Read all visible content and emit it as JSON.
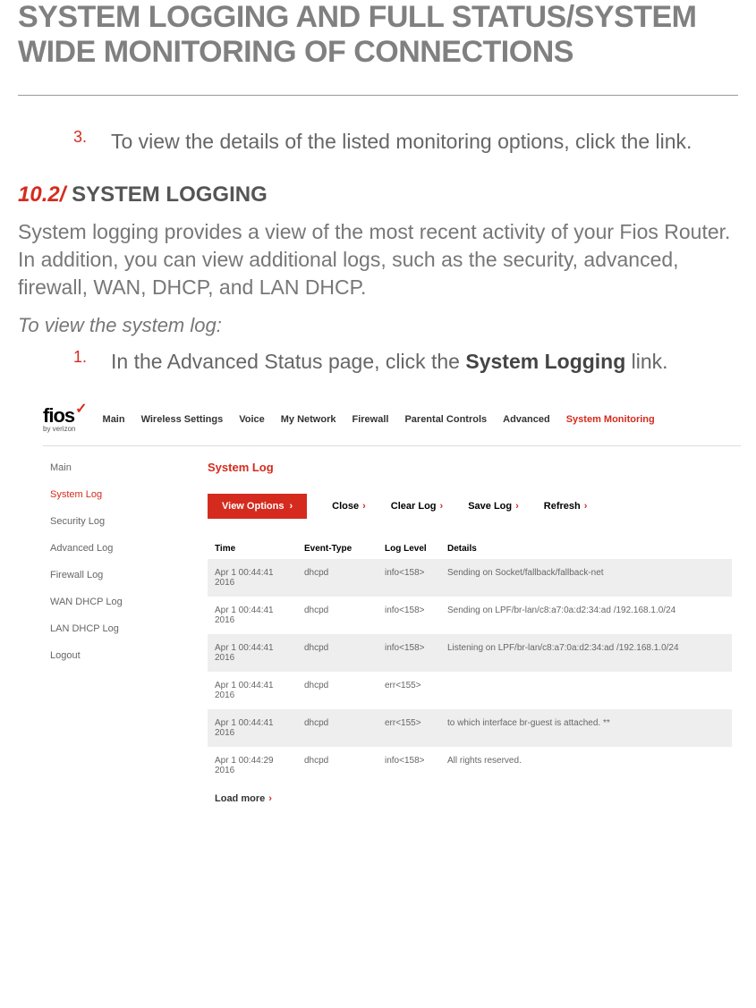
{
  "page_title": "SYSTEM LOGGING AND FULL STATUS/SYSTEM WIDE MONITORING OF CONNECTIONS",
  "step3": {
    "num": "3.",
    "text": "To view the details of the listed monitoring options, click the link."
  },
  "section": {
    "num": "10.2/",
    "title": "SYSTEM LOGGING"
  },
  "intro": "System logging provides a view of the most recent activity of your Fios Router. In addition, you can view additional logs, such as the security, advanced, firewall, WAN, DHCP, and LAN DHCP.",
  "intro2": "To view the system log:",
  "step1": {
    "num": "1.",
    "pre": "In the Advanced Status page, click the ",
    "bold": "System Logging",
    "post": " link."
  },
  "shot": {
    "logo": {
      "fios": "fios",
      "sub": "by verizon"
    },
    "topnav": [
      "Main",
      "Wireless Settings",
      "Voice",
      "My Network",
      "Firewall",
      "Parental Controls",
      "Advanced",
      "System Monitoring"
    ],
    "topnav_active_index": 7,
    "sidebar": [
      "Main",
      "System Log",
      "Security Log",
      "Advanced Log",
      "Firewall Log",
      "WAN DHCP Log",
      "LAN DHCP Log",
      "Logout"
    ],
    "sidebar_active_index": 1,
    "panel_title": "System Log",
    "actions": {
      "view_options": "View Options",
      "close": "Close",
      "clear": "Clear Log",
      "save": "Save Log",
      "refresh": "Refresh"
    },
    "columns": [
      "Time",
      "Event-Type",
      "Log Level",
      "Details"
    ],
    "rows": [
      {
        "time": "Apr 1 00:44:41 2016",
        "evt": "dhcpd",
        "lvl": "info<158>",
        "det": "Sending on Socket/fallback/fallback-net"
      },
      {
        "time": "Apr 1 00:44:41 2016",
        "evt": "dhcpd",
        "lvl": "info<158>",
        "det": "Sending on LPF/br-lan/c8:a7:0a:d2:34:ad /192.168.1.0/24"
      },
      {
        "time": "Apr 1 00:44:41 2016",
        "evt": "dhcpd",
        "lvl": "info<158>",
        "det": "Listening on LPF/br-lan/c8:a7:0a:d2:34:ad /192.168.1.0/24"
      },
      {
        "time": "Apr 1 00:44:41 2016",
        "evt": "dhcpd",
        "lvl": "err<155>",
        "det": ""
      },
      {
        "time": "Apr 1 00:44:41 2016",
        "evt": "dhcpd",
        "lvl": "err<155>",
        "det": "to which interface br-guest is attached. **"
      },
      {
        "time": "Apr 1 00:44:29 2016",
        "evt": "dhcpd",
        "lvl": "info<158>",
        "det": "All rights reserved."
      }
    ],
    "loadmore": "Load more"
  }
}
